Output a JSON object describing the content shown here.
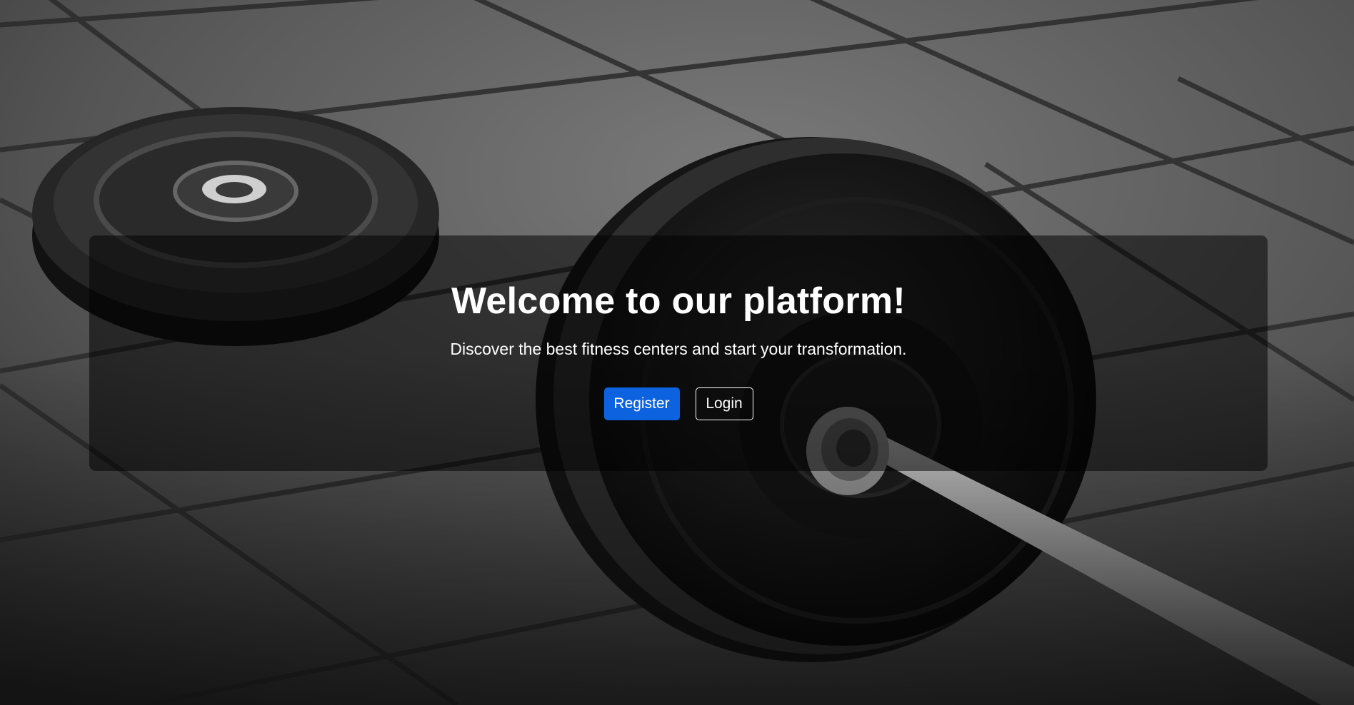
{
  "hero": {
    "title": "Welcome to our platform!",
    "subtitle": "Discover the best fitness centers and start your transformation."
  },
  "actions": {
    "register_label": "Register",
    "login_label": "Login"
  },
  "background": {
    "subject": "barbell-weight-plates-photo"
  },
  "colors": {
    "primary": "#0d62e0",
    "overlay": "rgba(0,0,0,0.52)",
    "text": "#ffffff"
  }
}
